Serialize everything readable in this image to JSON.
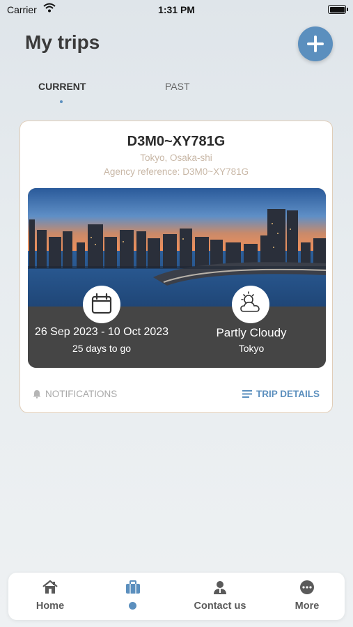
{
  "status_bar": {
    "carrier": "Carrier",
    "time": "1:31 PM"
  },
  "header": {
    "title": "My trips",
    "add_icon": "plus-icon"
  },
  "tabs": [
    {
      "label": "CURRENT",
      "active": true
    },
    {
      "label": "PAST",
      "active": false
    }
  ],
  "trip": {
    "code": "D3M0~XY781G",
    "location": "Tokyo, Osaka-shi",
    "agency_label": "Agency reference:",
    "agency_ref": "D3M0~XY781G",
    "image": "tokyo-skyline-at-dusk",
    "dates": "26 Sep 2023 - 10 Oct 2023",
    "days_to_go": "25 days to go",
    "weather": "Partly Cloudy",
    "weather_city": "Tokyo",
    "notifications_label": "NOTIFICATIONS",
    "details_label": "TRIP DETAILS"
  },
  "bottom_nav": [
    {
      "label": "Home",
      "icon": "home-icon"
    },
    {
      "label": "",
      "icon": "briefcase-icon",
      "active": true
    },
    {
      "label": "Contact us",
      "icon": "person-icon"
    },
    {
      "label": "More",
      "icon": "more-icon"
    }
  ],
  "colors": {
    "accent": "#5b8fbe",
    "panel": "#454545",
    "muted_text": "#c8b7a6"
  }
}
